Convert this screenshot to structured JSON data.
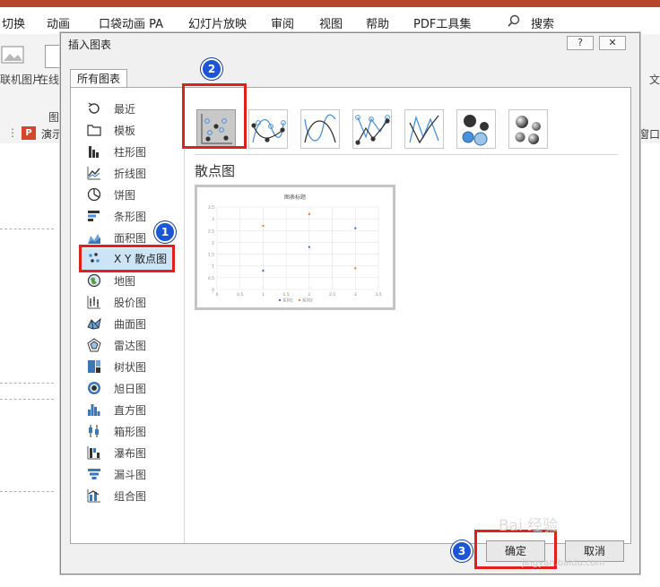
{
  "menubar": {
    "items": [
      "切换",
      "动画",
      "口袋动画 PA",
      "幻灯片放映",
      "审阅",
      "视图",
      "帮助",
      "PDF工具集"
    ],
    "search_label": "搜索"
  },
  "ribbon": {
    "left_label": "联机图片",
    "left_label2": "在线",
    "right_label": "文",
    "group_label": "图"
  },
  "tabstrip": {
    "doc_tab_label": "演示",
    "window_label": "窗口"
  },
  "dialog": {
    "title": "插入图表",
    "help_button": "?",
    "close_button": "✕",
    "tab_label": "所有图表",
    "chart_types": [
      {
        "label": "最近",
        "icon": "recent-icon"
      },
      {
        "label": "模板",
        "icon": "template-folder-icon"
      },
      {
        "label": "柱形图",
        "icon": "column-chart-icon"
      },
      {
        "label": "折线图",
        "icon": "line-chart-icon"
      },
      {
        "label": "饼图",
        "icon": "pie-chart-icon"
      },
      {
        "label": "条形图",
        "icon": "bar-chart-icon"
      },
      {
        "label": "面积图",
        "icon": "area-chart-icon"
      },
      {
        "label": "X Y 散点图",
        "icon": "scatter-chart-icon"
      },
      {
        "label": "地图",
        "icon": "map-chart-icon"
      },
      {
        "label": "股价图",
        "icon": "stock-chart-icon"
      },
      {
        "label": "曲面图",
        "icon": "surface-chart-icon"
      },
      {
        "label": "雷达图",
        "icon": "radar-chart-icon"
      },
      {
        "label": "树状图",
        "icon": "treemap-chart-icon"
      },
      {
        "label": "旭日图",
        "icon": "sunburst-chart-icon"
      },
      {
        "label": "直方图",
        "icon": "histogram-chart-icon"
      },
      {
        "label": "箱形图",
        "icon": "box-whisker-chart-icon"
      },
      {
        "label": "瀑布图",
        "icon": "waterfall-chart-icon"
      },
      {
        "label": "漏斗图",
        "icon": "funnel-chart-icon"
      },
      {
        "label": "组合图",
        "icon": "combo-chart-icon"
      }
    ],
    "selected_type": "X Y 散点图",
    "subtypes": [
      {
        "name": "scatter",
        "icon": "scatter-subtype-icon"
      },
      {
        "name": "scatter-smooth-markers",
        "icon": "scatter-smooth-markers-icon"
      },
      {
        "name": "scatter-smooth-lines",
        "icon": "scatter-smooth-lines-icon"
      },
      {
        "name": "scatter-straight-markers",
        "icon": "scatter-straight-markers-icon"
      },
      {
        "name": "scatter-straight-lines",
        "icon": "scatter-straight-lines-icon"
      },
      {
        "name": "bubble",
        "icon": "bubble-icon"
      },
      {
        "name": "bubble-3d",
        "icon": "bubble-3d-icon"
      }
    ],
    "section_title": "散点图",
    "preview": {
      "title": "图表标题",
      "x_ticks": [
        "0",
        "0.5",
        "1",
        "1.5",
        "2",
        "2.5",
        "3",
        "3.5"
      ],
      "y_ticks": [
        "0",
        "0.5",
        "1",
        "1.5",
        "2",
        "2.5",
        "3",
        "3.5"
      ],
      "legend": [
        "系列1",
        "系列2"
      ]
    },
    "ok_button": "确定",
    "cancel_button": "取消"
  },
  "annotations": {
    "badge1": "1",
    "badge2": "2",
    "badge3": "3",
    "color_badge": "#1a56d6",
    "color_box": "#e0201b"
  },
  "watermark": {
    "text": "Bai 经验",
    "url": "jingyan.baidu.com"
  },
  "chart_data": {
    "type": "scatter",
    "title": "图表标题",
    "xlabel": "",
    "ylabel": "",
    "xlim": [
      0,
      3.5
    ],
    "ylim": [
      0,
      3.5
    ],
    "grid": true,
    "legend_position": "bottom",
    "series": [
      {
        "name": "系列1",
        "color": "#4472c4",
        "x": [
          1,
          2,
          3
        ],
        "y": [
          0.8,
          1.8,
          2.6
        ]
      },
      {
        "name": "系列2",
        "color": "#ed7d31",
        "x": [
          1,
          2,
          3
        ],
        "y": [
          2.7,
          3.2,
          0.9
        ]
      }
    ]
  }
}
